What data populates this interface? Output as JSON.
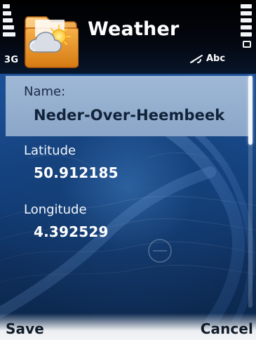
{
  "status": {
    "network": "3G",
    "input_mode": "Abc"
  },
  "app": {
    "title": "Weather",
    "icon": "weather-folder-icon"
  },
  "form": {
    "fields": [
      {
        "label": "Name:",
        "value": "Neder-Over-Heembeek"
      },
      {
        "label": "Latitude",
        "value": "50.912185"
      },
      {
        "label": "Longitude",
        "value": "4.392529"
      }
    ]
  },
  "softkeys": {
    "left": "Save",
    "right": "Cancel"
  },
  "colors": {
    "background_top": "#1f5aa6",
    "selection": "#9fb8d6",
    "text_light": "#ffffff"
  }
}
